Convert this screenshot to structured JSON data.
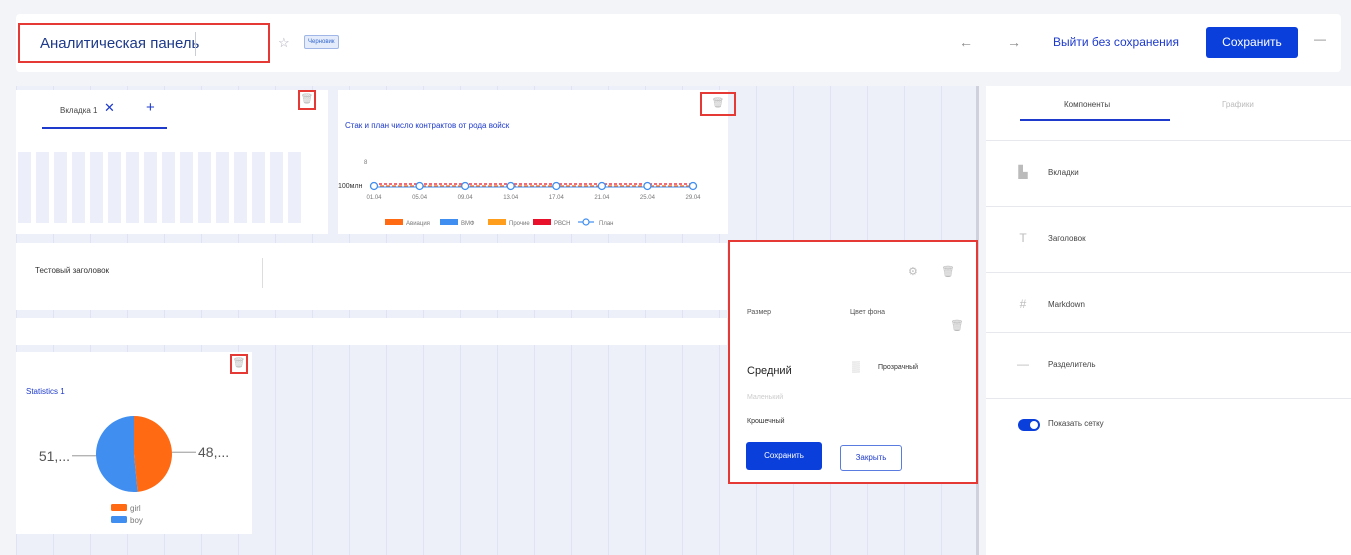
{
  "topbar": {
    "title": "Аналитическая панель",
    "badge": "Черновик",
    "back_glyph": "←",
    "forward_glyph": "→",
    "exit_label": "Выйти без сохранения",
    "save_label": "Сохранить",
    "more_glyph": "—",
    "star_glyph": "☆"
  },
  "tabs_widget": {
    "tab_label": "Вкладка 1",
    "close_glyph": "✕",
    "add_glyph": "+"
  },
  "chart_widget": {
    "title": "Стак и план число контрактов от рода войск"
  },
  "chart_data": {
    "type": "line",
    "title": "Стак и план число контрактов от рода войск",
    "categories": [
      "01.04",
      "05.04",
      "09.04",
      "13.04",
      "17.04",
      "21.04",
      "25.04",
      "29.04"
    ],
    "y_tick_label": "100млн",
    "y_top_tick": "8",
    "series": [
      {
        "name": "Авиация",
        "color": "#ff6a13"
      },
      {
        "name": "ВМФ",
        "color": "#3f8ef0"
      },
      {
        "name": "Прочие",
        "color": "#ff9d1c"
      },
      {
        "name": "РВСН",
        "color": "#e8102b"
      },
      {
        "name": "План",
        "color": "#3f8ef0"
      }
    ],
    "legend_position": "bottom"
  },
  "header_widget": {
    "text": "Тестовый заголовок"
  },
  "stat_widget": {
    "title": "Statistics 1",
    "pie": {
      "type": "pie",
      "slices": [
        {
          "name": "girl",
          "value": 48,
          "label": "48,...",
          "color": "#ff6a13"
        },
        {
          "name": "boy",
          "value": 51,
          "label": "51,...",
          "color": "#3f8ef0"
        }
      ],
      "legend": [
        "girl",
        "boy"
      ]
    }
  },
  "popup": {
    "size_label": "Размер",
    "bg_label": "Цвет фона",
    "size_value": "Средний",
    "size_small": "Маленький",
    "size_tiny": "Крошечный",
    "bg_value": "Прозрачный",
    "save_label": "Сохранить",
    "close_label": "Закрыть",
    "settings_glyph": "⚙",
    "trash_glyph": "🗑"
  },
  "right_panel": {
    "tabs": [
      {
        "label": "Компоненты",
        "active": true
      },
      {
        "label": "Графики",
        "active": false
      }
    ],
    "items": [
      {
        "label": "Вкладки",
        "icon": "tabs-icon",
        "glyph": "▙"
      },
      {
        "label": "Заголовок",
        "icon": "heading-icon",
        "glyph": "T"
      },
      {
        "label": "Markdown",
        "icon": "hash-icon",
        "glyph": "#"
      },
      {
        "label": "Разделитель",
        "icon": "divider-icon",
        "glyph": "—"
      }
    ],
    "toggle_label": "Показать сетку",
    "toggle_on": true
  }
}
